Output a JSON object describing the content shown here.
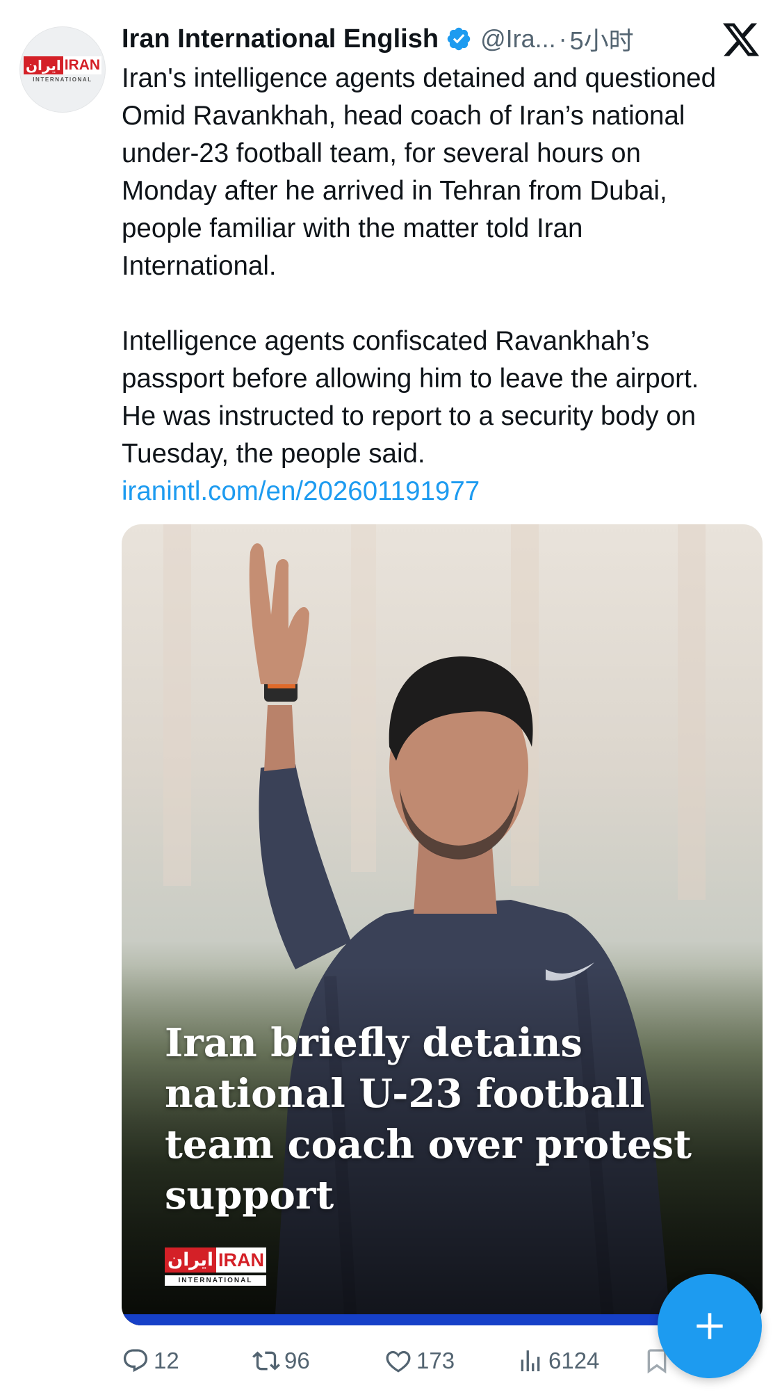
{
  "colors": {
    "accent": "#1d9bf0",
    "text_primary": "#0f1419",
    "text_secondary": "#536471",
    "brand_red": "#d42027",
    "media_bar": "#1640c8"
  },
  "author": {
    "avatar_logo_fa": "ایران",
    "avatar_logo_en": "IRAN",
    "avatar_logo_sub": "INTERNATIONAL",
    "name": "Iran International English",
    "verified_icon": "verified-badge-icon",
    "handle": "@Ira...",
    "separator": "·",
    "time": "5小时"
  },
  "platform_icon": "x-logo-icon",
  "tweet": {
    "paragraph_1": "Iran's intelligence agents detained and questioned Omid Ravankhah, head coach of Iran’s national under-23 football team, for several hours on Monday after he arrived in Tehran from Dubai, people familiar with the matter told Iran International.",
    "paragraph_2": "Intelligence agents confiscated Ravankhah’s passport before allowing him to leave the airport. He was instructed to report to a security body on Tuesday, the people said.",
    "link": "iranintl.com/en/202601191977"
  },
  "media": {
    "headline": "Iran briefly detains national U-23 football team coach over protest support",
    "logo_fa": "ایران",
    "logo_en": "IRAN",
    "logo_sub": "INTERNATIONAL"
  },
  "actions": {
    "reply_count": "12",
    "retweet_count": "96",
    "like_count": "173",
    "views_count": "6124"
  },
  "fab": {
    "icon": "plus-icon"
  }
}
